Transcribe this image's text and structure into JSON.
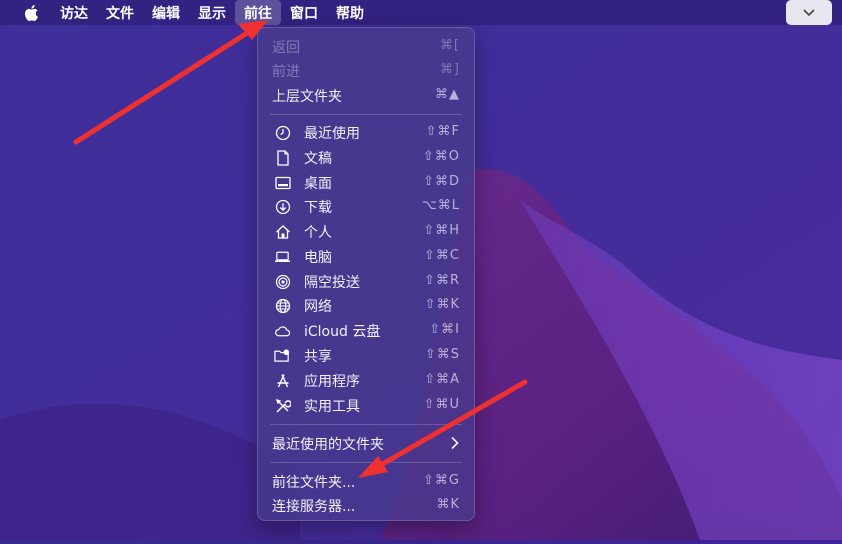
{
  "menubar": {
    "apple_icon": "apple-logo-icon",
    "items": [
      "访达",
      "文件",
      "编辑",
      "显示",
      "前往",
      "窗口",
      "帮助"
    ],
    "active_index": 4,
    "right_icon": "chevron-down-icon"
  },
  "go_menu": {
    "nav": [
      {
        "label": "返回",
        "shortcut": "⌘[",
        "enabled": false
      },
      {
        "label": "前进",
        "shortcut": "⌘]",
        "enabled": false
      },
      {
        "label": "上层文件夹",
        "shortcut": "⌘▲",
        "enabled": true
      }
    ],
    "places": [
      {
        "label": "最近使用",
        "shortcut": "⇧⌘F",
        "icon": "clock-icon"
      },
      {
        "label": "文稿",
        "shortcut": "⇧⌘O",
        "icon": "document-icon"
      },
      {
        "label": "桌面",
        "shortcut": "⇧⌘D",
        "icon": "desktop-icon"
      },
      {
        "label": "下载",
        "shortcut": "⌥⌘L",
        "icon": "download-icon"
      },
      {
        "label": "个人",
        "shortcut": "⇧⌘H",
        "icon": "home-icon"
      },
      {
        "label": "电脑",
        "shortcut": "⇧⌘C",
        "icon": "laptop-icon"
      },
      {
        "label": "隔空投送",
        "shortcut": "⇧⌘R",
        "icon": "airdrop-icon"
      },
      {
        "label": "网络",
        "shortcut": "⇧⌘K",
        "icon": "globe-icon"
      },
      {
        "label": "iCloud 云盘",
        "shortcut": "⇧⌘I",
        "icon": "cloud-icon"
      },
      {
        "label": "共享",
        "shortcut": "⇧⌘S",
        "icon": "shared-folder-icon"
      },
      {
        "label": "应用程序",
        "shortcut": "⇧⌘A",
        "icon": "applications-icon"
      },
      {
        "label": "实用工具",
        "shortcut": "⇧⌘U",
        "icon": "utilities-icon"
      }
    ],
    "recent_folders": {
      "label": "最近使用的文件夹",
      "icon": "chevron-right-icon"
    },
    "goto": [
      {
        "label": "前往文件夹...",
        "shortcut": "⇧⌘G"
      },
      {
        "label": "连接服务器...",
        "shortcut": "⌘K"
      }
    ]
  }
}
